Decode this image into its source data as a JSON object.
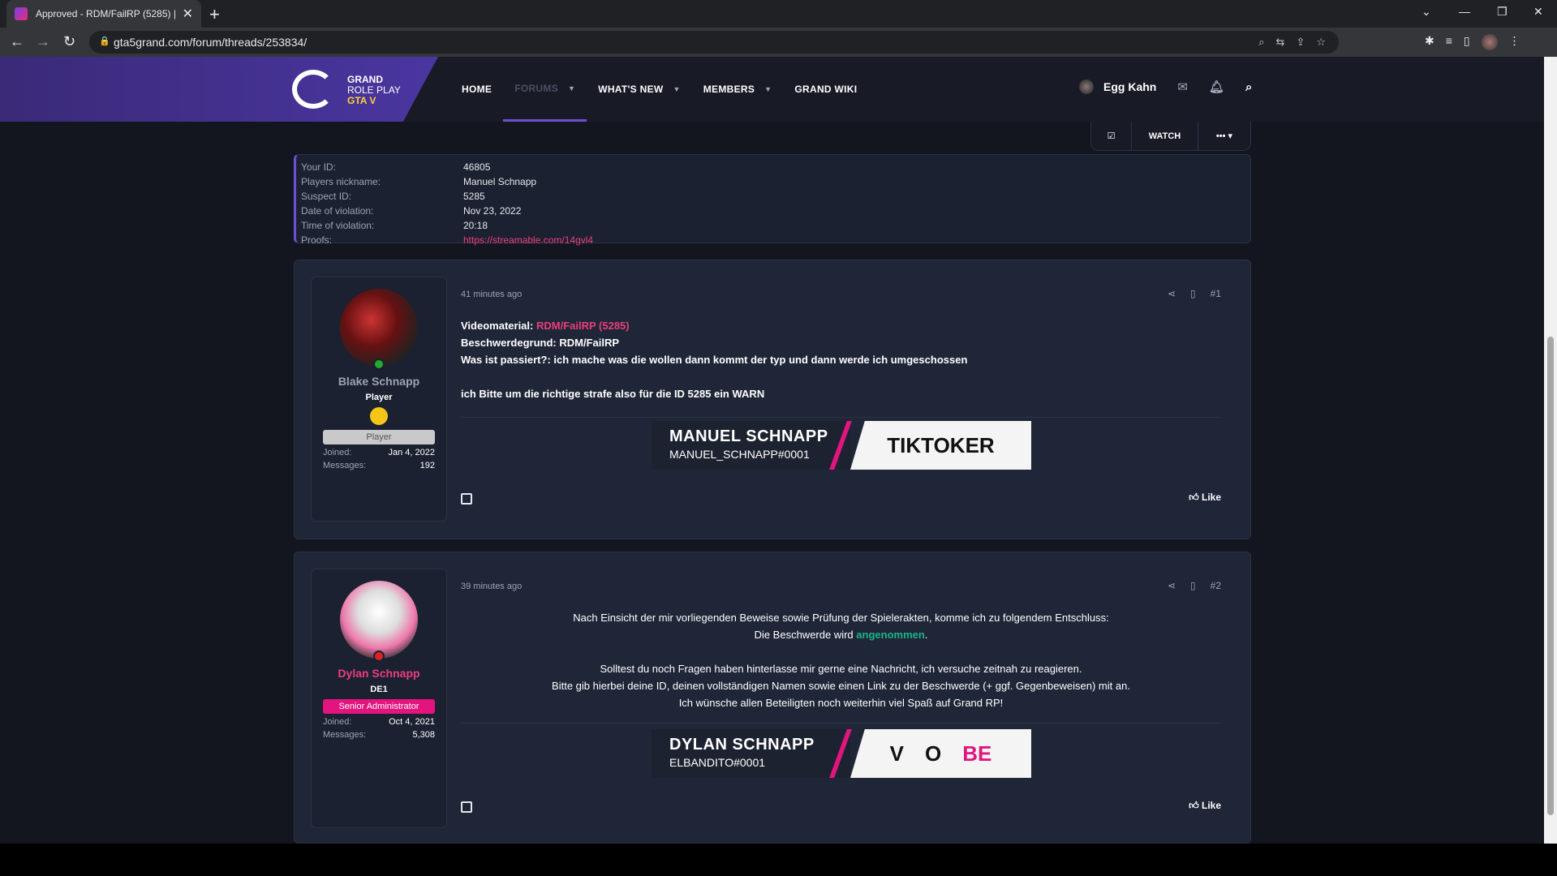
{
  "browser": {
    "tab_title": "Approved - RDM/FailRP (5285) | ...",
    "url": "gta5grand.com/forum/threads/253834/",
    "new_tab": "+",
    "close": "✕"
  },
  "site": {
    "brand_line1": "GRAND",
    "brand_line2": "ROLE PLAY",
    "brand_line3": "GTA V",
    "nav": [
      {
        "label": "HOME"
      },
      {
        "label": "FORUMS"
      },
      {
        "label": "WHAT'S NEW"
      },
      {
        "label": "MEMBERS"
      },
      {
        "label": "GRAND WIKI"
      }
    ],
    "username": "Egg Kahn",
    "watch_label": "WATCH",
    "more_label": "•••"
  },
  "info": [
    {
      "k": "Your ID:",
      "v": "46805"
    },
    {
      "k": "Players nickname:",
      "v": "Manuel Schnapp"
    },
    {
      "k": "Suspect ID:",
      "v": "5285"
    },
    {
      "k": "Date of violation:",
      "v": "Nov 23, 2022"
    },
    {
      "k": "Time of violation:",
      "v": "20:18"
    },
    {
      "k": "Proofs:",
      "v": "https://streamable.com/14gvl4"
    }
  ],
  "post1": {
    "user": "Blake Schnapp",
    "title": "Player",
    "badge": "Player",
    "joined_k": "Joined:",
    "joined_v": "Jan 4, 2022",
    "messages_k": "Messages:",
    "messages_v": "192",
    "time": "41 minutes ago",
    "num": "#1",
    "line1_label": "Videomaterial:",
    "line1_link": "RDM/FailRP (5285)",
    "line2": "Beschwerdegrund: RDM/FailRP",
    "line3": "Was ist passiert?: ich mache was die wollen dann kommt der typ und dann werde ich umgeschossen",
    "line4": "ich Bitte um die richtige strafe also für die ID 5285 ein WARN",
    "sig_name": "MANUEL SCHNAPP",
    "sig_tag": "MANUEL_SCHNAPP#0001",
    "sig_right": "TIKTOKER",
    "like": "Like"
  },
  "post2": {
    "user": "Dylan Schnapp",
    "title": "DE1",
    "badge": "Senior Administrator",
    "joined_k": "Joined:",
    "joined_v": "Oct 4, 2021",
    "messages_k": "Messages:",
    "messages_v": "5,308",
    "time": "39 minutes ago",
    "num": "#2",
    "l1": "Nach Einsicht der mir vorliegenden Beweise sowie Prüfung der Spielerakten, komme ich zu folgendem Entschluss:",
    "l2_pre": "Die Beschwerde wird ",
    "l2_word": "angenommen",
    "l2_post": ".",
    "l3": "Solltest du noch Fragen haben hinterlasse mir gerne eine Nachricht, ich versuche zeitnah zu reagieren.",
    "l4": "Bitte gib hierbei deine ID, deinen vollständigen Namen sowie einen Link zu der Beschwerde (+ ggf. Gegenbeweisen) mit an.",
    "l5": "Ich wünsche allen Beteiligten noch weiterhin viel Spaß auf Grand RP!",
    "sig_name": "DYLAN SCHNAPP",
    "sig_tag": "ELBANDITO#0001",
    "sig_right1": "V",
    "sig_right2": "O",
    "sig_right3": "BE",
    "like": "Like"
  },
  "colors": {
    "accent": "#6d4fd6",
    "pink": "#ec3d7c",
    "green": "#1db48c"
  }
}
